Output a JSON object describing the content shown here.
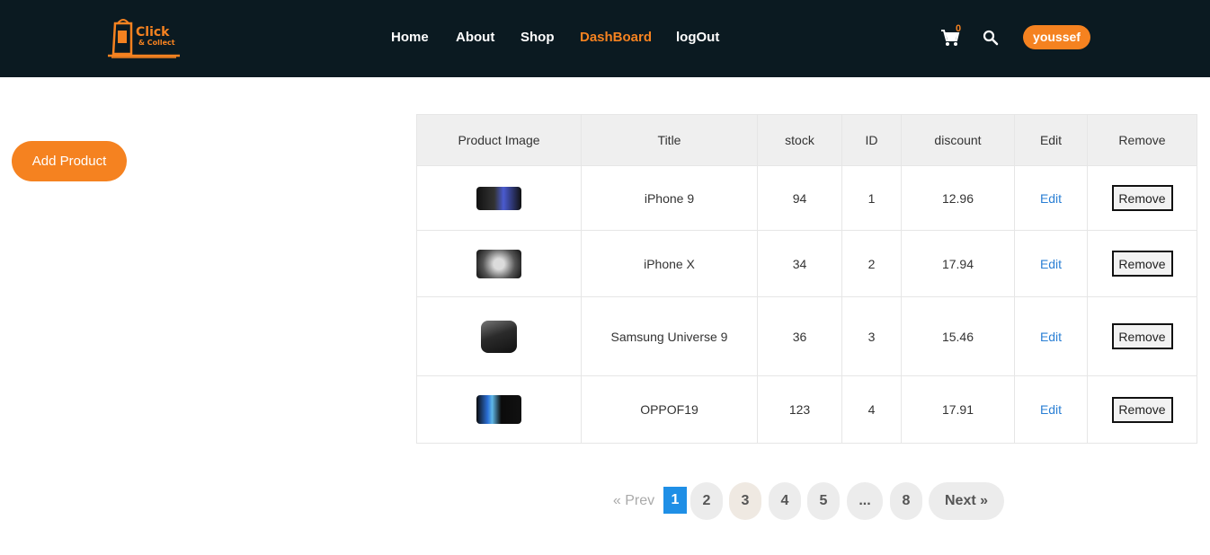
{
  "brand": {
    "logo_line1": "Click",
    "logo_line2": "& Collect",
    "accent": "#f58220",
    "nav_bg": "#0b1a21"
  },
  "nav": {
    "home": "Home",
    "about": "About",
    "shop": "Shop",
    "dashboard": "DashBoard",
    "logout": "logOut"
  },
  "header": {
    "cart_icon": "cart-icon",
    "cart_count": "0",
    "search_icon": "search-icon",
    "user": "youssef"
  },
  "actions": {
    "add_product": "Add Product"
  },
  "table": {
    "headers": [
      "Product Image",
      "Title",
      "stock",
      "ID",
      "discount",
      "Edit",
      "Remove"
    ],
    "rows": [
      {
        "title": "iPhone 9",
        "stock": "94",
        "id": "1",
        "discount": "12.96",
        "edit": "Edit",
        "remove": "Remove"
      },
      {
        "title": "iPhone X",
        "stock": "34",
        "id": "2",
        "discount": "17.94",
        "edit": "Edit",
        "remove": "Remove"
      },
      {
        "title": "Samsung Universe 9",
        "stock": "36",
        "id": "3",
        "discount": "15.46",
        "edit": "Edit",
        "remove": "Remove"
      },
      {
        "title": "OPPOF19",
        "stock": "123",
        "id": "4",
        "discount": "17.91",
        "edit": "Edit",
        "remove": "Remove"
      }
    ]
  },
  "pagination": {
    "prev": "«  Prev",
    "pages": [
      "1",
      "2",
      "3",
      "4",
      "5",
      "...",
      "8"
    ],
    "current": "1",
    "next": "Next  »"
  }
}
